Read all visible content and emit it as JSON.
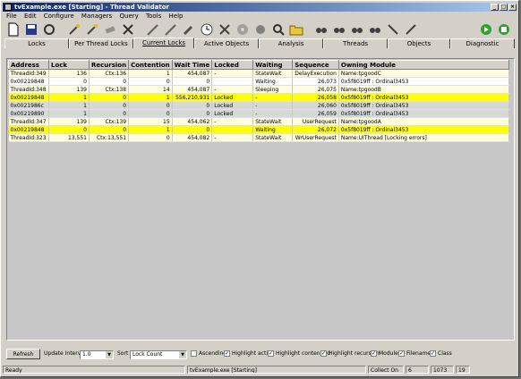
{
  "window": {
    "title": "tvExample.exe [Starting] - Thread Validator"
  },
  "menu": [
    "File",
    "Edit",
    "Configure",
    "Managers",
    "Query",
    "Tools",
    "Help"
  ],
  "toolbar": {
    "icons": [
      "new-file-icon",
      "save-icon",
      "refresh-icon",
      "wand-icon",
      "wand-icon",
      "eraser-icon",
      "scissors-icon",
      "pen-icon",
      "pen-icon",
      "clock-icon",
      "tools-icon",
      "gear-icon",
      "disc-icon",
      "magnifier-icon",
      "chart-icon",
      "folder-icon",
      "binoculars-icon",
      "binoculars-icon",
      "binoculars-icon",
      "binoculars-icon",
      "arrow-icon",
      "arrow-icon"
    ],
    "run_icons": [
      "go-icon",
      "stop-icon"
    ]
  },
  "tabs": [
    "Locks",
    "Per Thread Locks",
    "Current Locks",
    "Active Objects",
    "Analysis",
    "Threads",
    "Objects",
    "Diagnostic"
  ],
  "active_tab": "Current Locks",
  "table": {
    "headers": [
      "Address",
      "Lock",
      "Recursion",
      "Contention",
      "Wait Time",
      "Locked",
      "Waiting",
      "Sequence",
      "Owning Module"
    ],
    "rows": [
      {
        "style": "cream",
        "cells": [
          "ThreadId:349",
          "136",
          "Ctx:136",
          "1",
          "454,087",
          "-",
          "StateWait",
          "DelayExecution",
          "Name:tpgoodC"
        ]
      },
      {
        "style": "white",
        "cells": [
          "0x00219848",
          "0",
          "0",
          "0",
          "0",
          "",
          "Waiting",
          "26,073",
          "0x5f8019ff : Ordinal3453"
        ]
      },
      {
        "style": "cream",
        "cells": [
          "ThreadId:348",
          "139",
          "Ctx:138",
          "14",
          "454,087",
          "-",
          "Sleeping",
          "26,075",
          "Name:tpgoodB"
        ]
      },
      {
        "style": "yellow",
        "cells": [
          "0x00219848",
          "1",
          "0",
          "1",
          "556,210,931",
          "Locked",
          "-",
          "26,058",
          "0x5f8019ff : Ordinal3453"
        ]
      },
      {
        "style": "gray",
        "cells": [
          "0x0021986c",
          "1",
          "0",
          "0",
          "0",
          "Locked",
          "-",
          "26,060",
          "0x5f8019ff : Ordinal3453"
        ]
      },
      {
        "style": "gray",
        "cells": [
          "0x00219890",
          "1",
          "0",
          "0",
          "0",
          "Locked",
          "-",
          "26,059",
          "0x5f8019ff : Ordinal3453"
        ]
      },
      {
        "style": "cream",
        "cells": [
          "ThreadId:347",
          "139",
          "Ctx:139",
          "15",
          "454,062",
          "-",
          "StateWait",
          "UserRequest",
          "Name:tpgoodA"
        ]
      },
      {
        "style": "yellow",
        "cells": [
          "0x00219848",
          "0",
          "0",
          "1",
          "0",
          "",
          "Waiting",
          "26,072",
          "0x5f8019ff : Ordinal3453"
        ]
      },
      {
        "style": "cream",
        "cells": [
          "ThreadId:323",
          "13,551",
          "Ctx:13,551",
          "0",
          "454,082",
          "-",
          "StateWait",
          "WrUserRequest",
          "Name:UIThread [Locking errors]"
        ]
      }
    ]
  },
  "controls": {
    "refresh_label": "Refresh",
    "update_interval_label": "Update Interval",
    "update_interval_value": "1.0",
    "sort_label": "Sort",
    "sort_value": "Lock Count",
    "checkboxes": [
      {
        "label": "Ascending",
        "checked": false
      },
      {
        "label": "Highlight active",
        "checked": true
      },
      {
        "label": "Highlight contended",
        "checked": true
      },
      {
        "label": "Highlight recursion",
        "checked": true
      },
      {
        "label": "Module",
        "checked": true
      },
      {
        "label": "Filename",
        "checked": true
      },
      {
        "label": "Class",
        "checked": true
      }
    ]
  },
  "status": {
    "ready": "Ready",
    "process": "tvExample.exe [Starting]",
    "collect": "Collect On",
    "count1": "6",
    "count2": "1073",
    "count3": "19"
  },
  "colors": {
    "cream": "#fffde0",
    "yellow": "#ffff00",
    "gray": "#d8d8d8",
    "title_start": "#0a246a"
  }
}
